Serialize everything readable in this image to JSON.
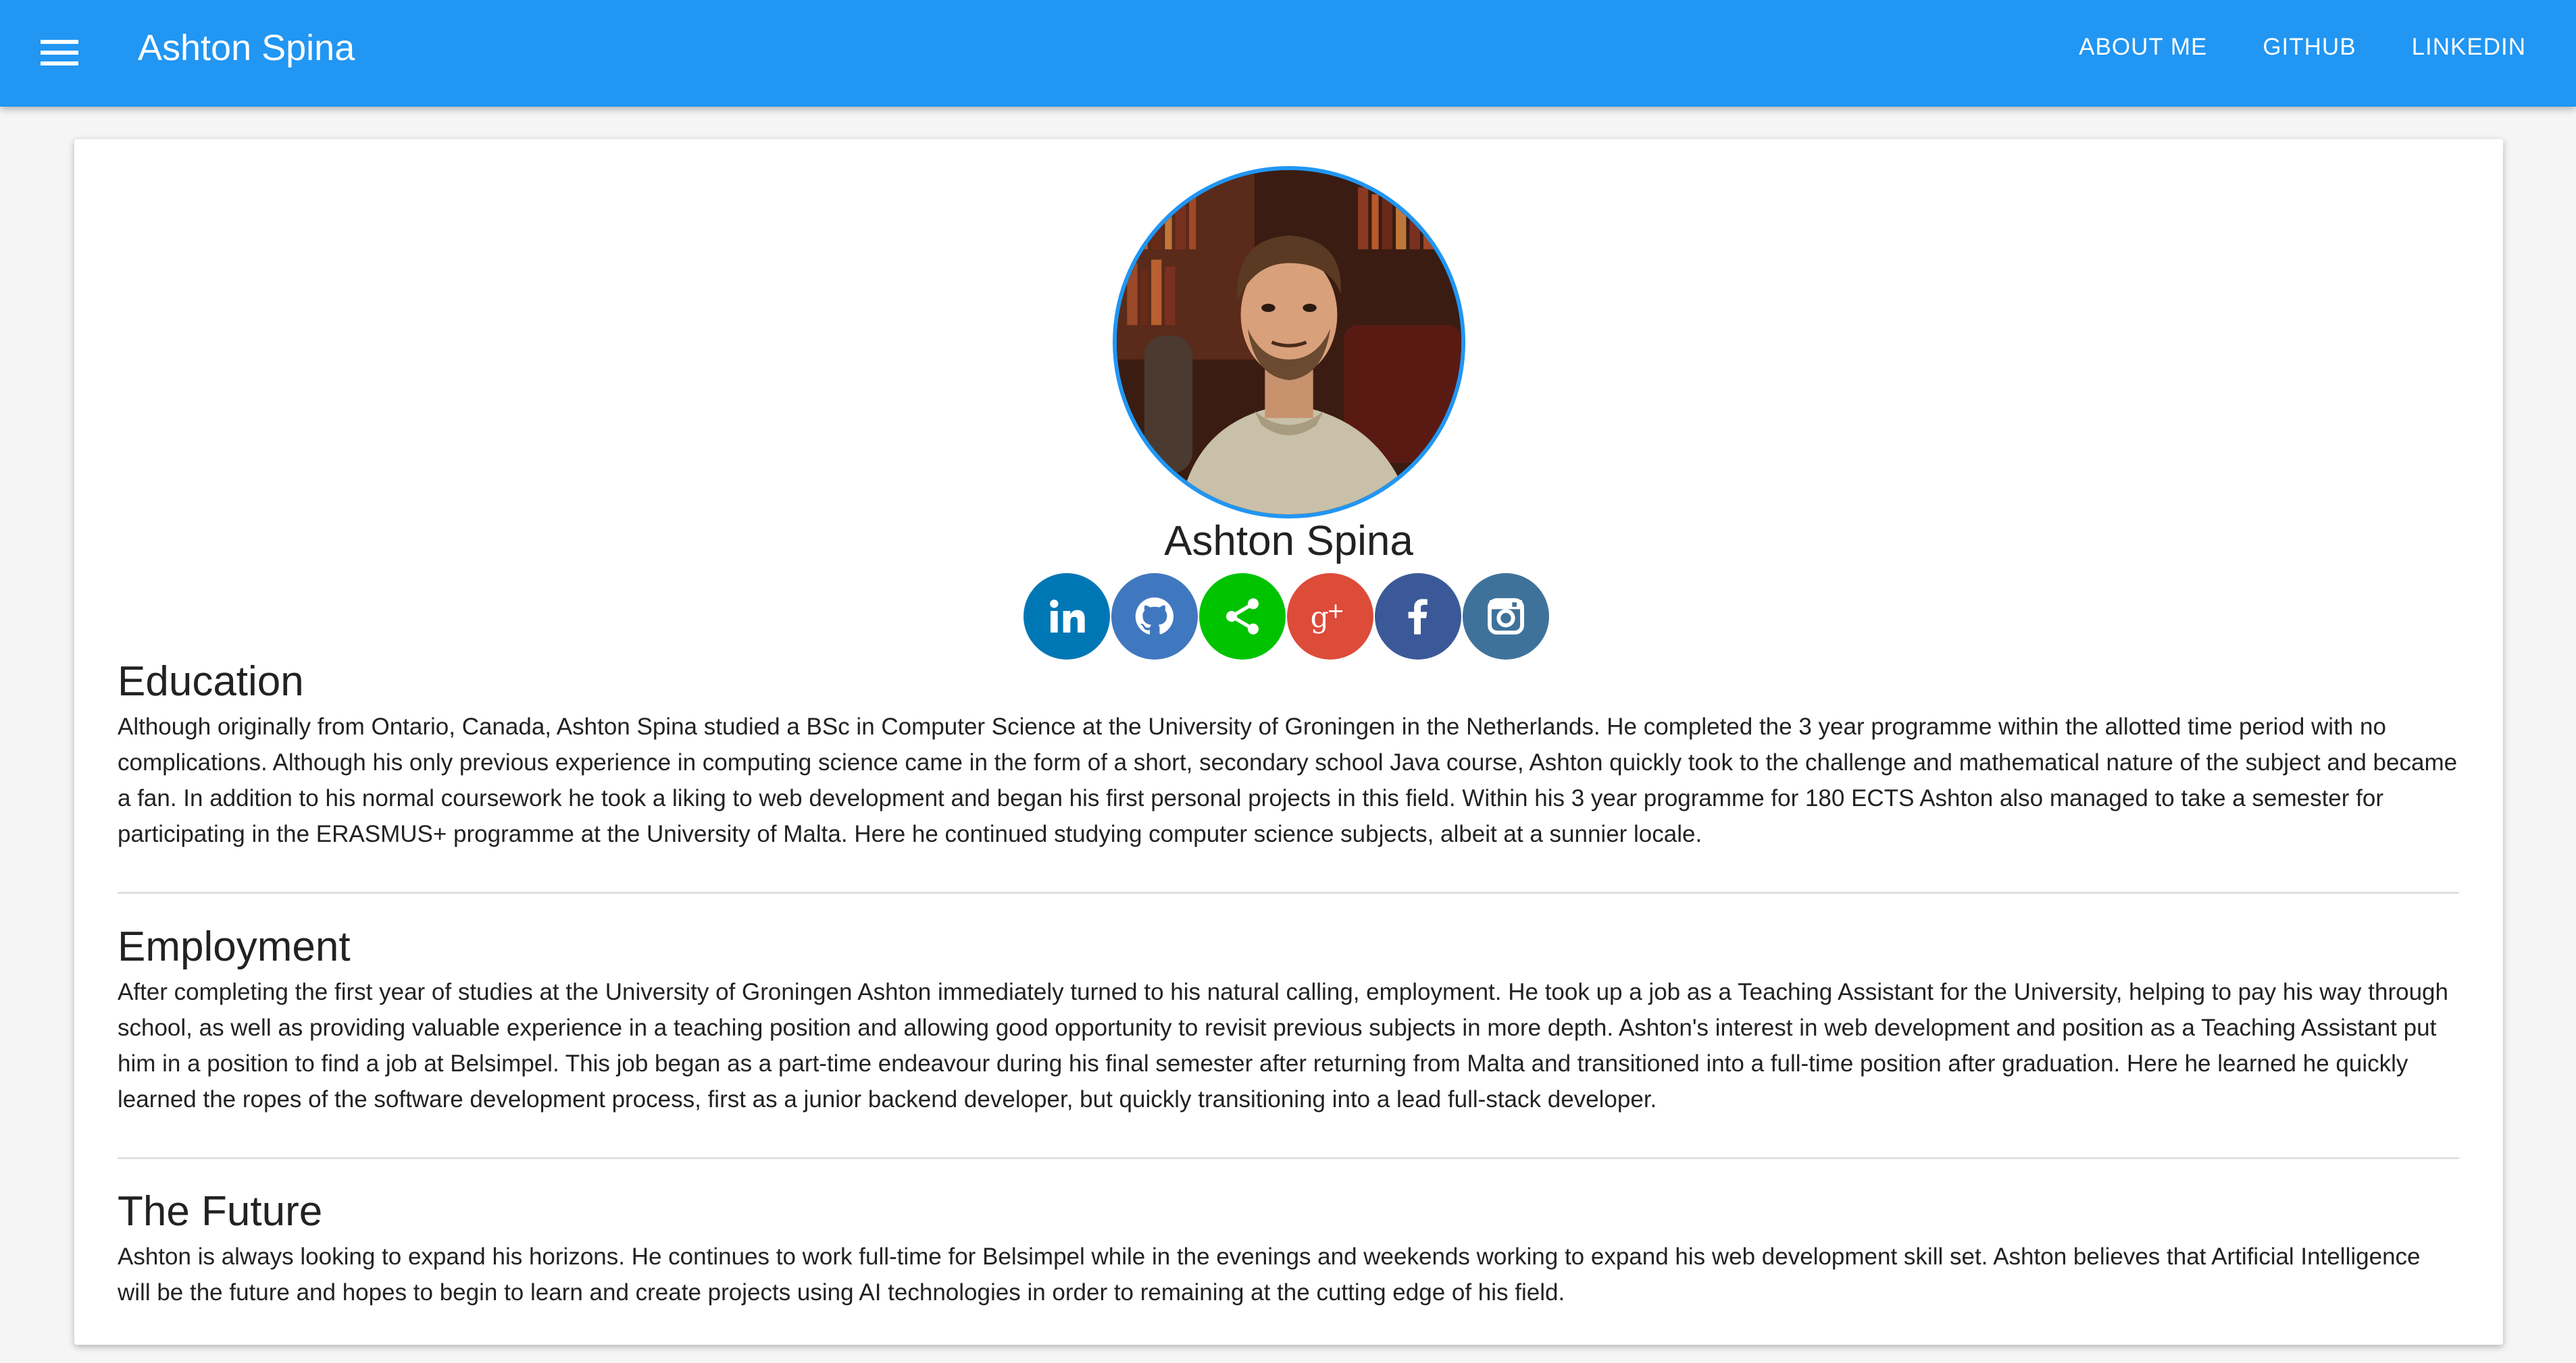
{
  "header": {
    "title": "Ashton Spina",
    "nav": [
      {
        "label": "ABOUT ME"
      },
      {
        "label": "GITHUB"
      },
      {
        "label": "LINKEDIN"
      }
    ]
  },
  "profile": {
    "name": "Ashton Spina",
    "socials": [
      {
        "icon": "linkedin-icon",
        "color": "#0077b5"
      },
      {
        "icon": "github-icon",
        "color": "#4078c0"
      },
      {
        "icon": "share-icon",
        "color": "#00c300"
      },
      {
        "icon": "google-plus-icon",
        "color": "#dd4b39"
      },
      {
        "icon": "facebook-icon",
        "color": "#3b5998"
      },
      {
        "icon": "instagram-icon",
        "color": "#3f729b"
      }
    ]
  },
  "sections": [
    {
      "heading": "Education",
      "body": "Although originally from Ontario, Canada, Ashton Spina studied a BSc in Computer Science at the University of Groningen in the Netherlands. He completed the 3 year programme within the allotted time period with no complications. Although his only previous experience in computing science came in the form of a short, secondary school Java course, Ashton quickly took to the challenge and mathematical nature of the subject and became a fan. In addition to his normal coursework he took a liking to web development and began his first personal projects in this field. Within his 3 year programme for 180 ECTS Ashton also managed to take a semester for participating in the ERASMUS+ programme at the University of Malta. Here he continued studying computer science subjects, albeit at a sunnier locale."
    },
    {
      "heading": "Employment",
      "body": "After completing the first year of studies at the University of Groningen Ashton immediately turned to his natural calling, employment. He took up a job as a Teaching Assistant for the University, helping to pay his way through school, as well as providing valuable experience in a teaching position and allowing good opportunity to revisit previous subjects in more depth. Ashton's interest in web development and position as a Teaching Assistant put him in a position to find a job at Belsimpel. This job began as a part-time endeavour during his final semester after returning from Malta and transitioned into a full-time position after graduation. Here he learned he quickly learned the ropes of the software development process, first as a junior backend developer, but quickly transitioning into a lead full-stack developer."
    },
    {
      "heading": "The Future",
      "body": "Ashton is always looking to expand his horizons. He continues to work full-time for Belsimpel while in the evenings and weekends working to expand his web development skill set. Ashton believes that Artificial Intelligence will be the future and hopes to begin to learn and create projects using AI technologies in order to remaining at the cutting edge of his field."
    }
  ],
  "colors": {
    "primary": "#2196f3",
    "background": "#f5f5f5"
  }
}
